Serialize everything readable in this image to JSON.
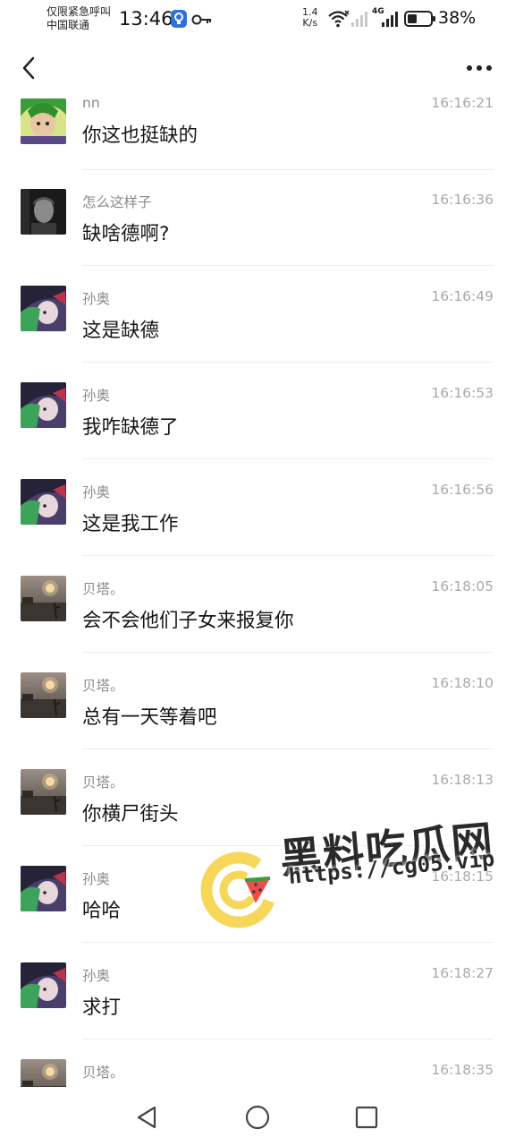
{
  "status_bar": {
    "emergency": "仅限紧急呼叫",
    "carrier": "中国联通",
    "time": "13:46",
    "speed_value": "1.4",
    "speed_unit": "K/s",
    "network": "4G",
    "battery": "38%"
  },
  "header": {
    "back_icon": "chevron-left-icon",
    "more_icon": "more-dots-icon"
  },
  "messages": [
    {
      "sender": "nn",
      "time": "16:16:21",
      "text": "你这也挺缺的",
      "avatar": "green-hair-character"
    },
    {
      "sender": "怎么这样子",
      "time": "16:16:36",
      "text": "缺啥德啊?",
      "avatar": "dark-portrait"
    },
    {
      "sender": "孙奥",
      "time": "16:16:49",
      "text": "这是缺德",
      "avatar": "anime-girl"
    },
    {
      "sender": "孙奥",
      "time": "16:16:53",
      "text": "我咋缺德了",
      "avatar": "anime-girl"
    },
    {
      "sender": "孙奥",
      "time": "16:16:56",
      "text": "这是我工作",
      "avatar": "anime-girl"
    },
    {
      "sender": "贝塔。",
      "time": "16:18:05",
      "text": "会不会他们子女来报复你",
      "avatar": "sunset-silhouette"
    },
    {
      "sender": "贝塔。",
      "time": "16:18:10",
      "text": "总有一天等着吧",
      "avatar": "sunset-silhouette"
    },
    {
      "sender": "贝塔。",
      "time": "16:18:13",
      "text": "你横尸街头",
      "avatar": "sunset-silhouette"
    },
    {
      "sender": "孙奥",
      "time": "16:18:15",
      "text": "哈哈",
      "avatar": "anime-girl"
    },
    {
      "sender": "孙奥",
      "time": "16:18:27",
      "text": "求打",
      "avatar": "anime-girl"
    },
    {
      "sender": "贝塔。",
      "time": "16:18:35",
      "text": "",
      "avatar": "sunset-silhouette"
    }
  ],
  "watermark": {
    "title": "黑料吃瓜网",
    "url": "https://cg05.vip"
  },
  "navbar": {
    "back": "triangle-back-icon",
    "home": "circle-home-icon",
    "recents": "square-recents-icon"
  }
}
